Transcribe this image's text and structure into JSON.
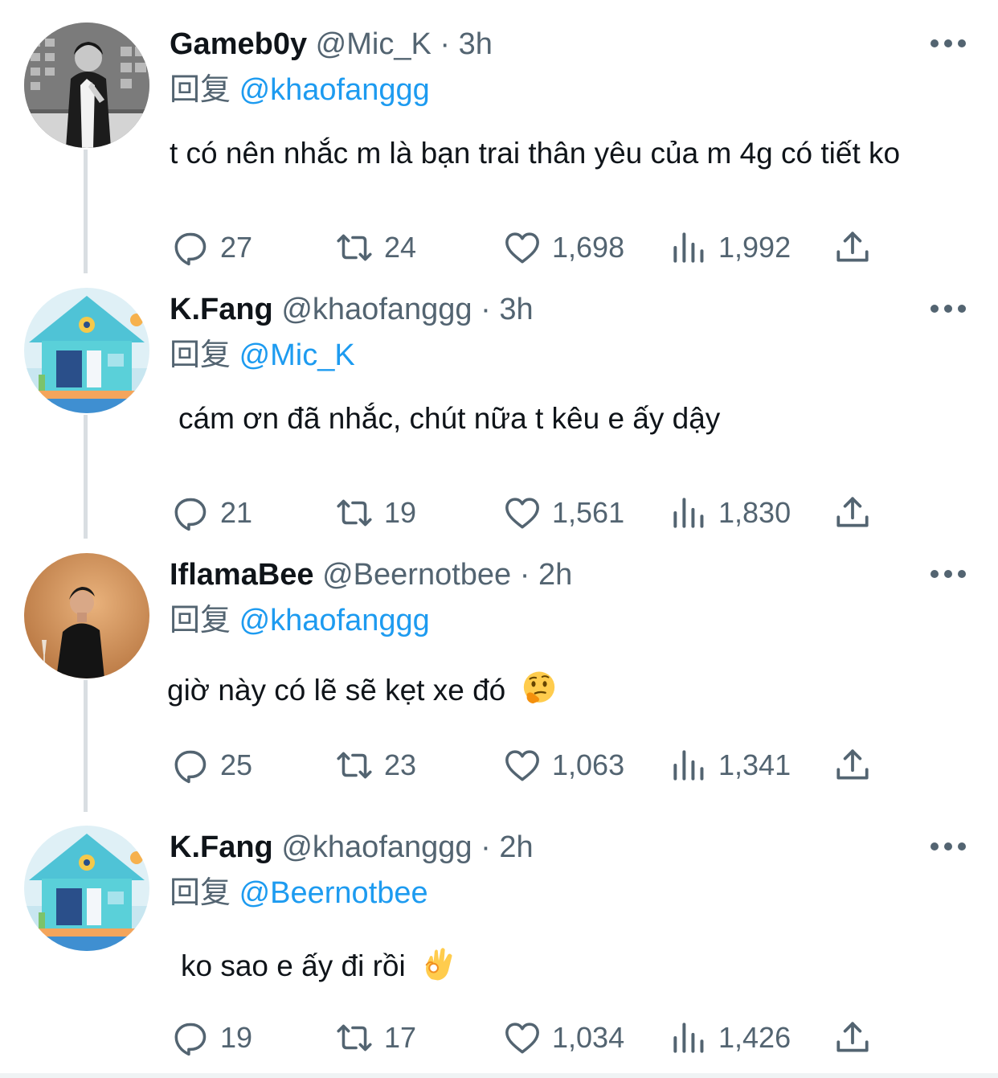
{
  "colors": {
    "text": "#0f1419",
    "secondary": "#536471",
    "link": "#1d9bf0",
    "thread_line": "#d9dee2"
  },
  "icons": {
    "reply": "speech-bubble-icon",
    "retweet": "retweet-arrows-icon",
    "like": "heart-icon",
    "views": "bar-chart-icon",
    "share": "share-upload-icon",
    "more": "more-dots-icon"
  },
  "tweets": [
    {
      "name": "Gameb0y",
      "handle": "@Mic_K",
      "time": "· 3h",
      "reply_label": "回复",
      "reply_to": "@khaofanggg",
      "text": "t có nên nhắc m là bạn trai thân yêu của m 4g có tiết ko",
      "replies": "27",
      "retweets": "24",
      "likes": "1,698",
      "views": "1,992"
    },
    {
      "name": "K.Fang",
      "handle": "@khaofanggg",
      "time": "· 3h",
      "reply_label": "回复",
      "reply_to": "@Mic_K",
      "text": "cám ơn đã nhắc, chút nữa t kêu e ấy dậy",
      "replies": "21",
      "retweets": "19",
      "likes": "1,561",
      "views": "1,830"
    },
    {
      "name": "IflamaBee",
      "handle": "@Beernotbee",
      "time": "· 2h",
      "reply_label": "回复",
      "reply_to": "@khaofanggg",
      "text": "giờ này có lẽ sẽ kẹt xe đó",
      "emoji": "thinking-face-emoji",
      "replies": "25",
      "retweets": "23",
      "likes": "1,063",
      "views": "1,341"
    },
    {
      "name": "K.Fang",
      "handle": "@khaofanggg",
      "time": "· 2h",
      "reply_label": "回复",
      "reply_to": "@Beernotbee",
      "text": "ko sao e ấy đi rồi",
      "emoji": "ok-hand-emoji",
      "replies": "19",
      "retweets": "17",
      "likes": "1,034",
      "views": "1,426"
    }
  ]
}
